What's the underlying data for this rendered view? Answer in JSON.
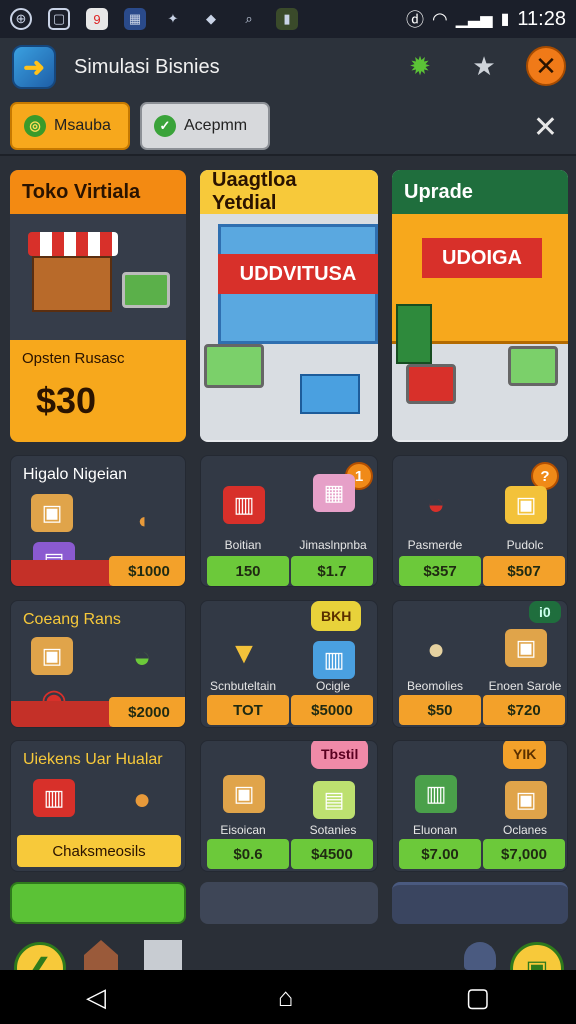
{
  "status": {
    "time": "11:28"
  },
  "header": {
    "title": "Simulasi Bisnies"
  },
  "tabs": [
    {
      "label": "Msauba"
    },
    {
      "label": "Acepmm"
    }
  ],
  "panels": [
    {
      "title": "Toko Virtiala",
      "footer_label": "Opsten Rusasc",
      "price": "$30"
    },
    {
      "title": "Uaagtloa Yetdial",
      "sign": "UDDVITUSA"
    },
    {
      "title": "Uprade",
      "sign": "UDOIGA"
    }
  ],
  "tiles": [
    {
      "label": "Higalo Nigeian",
      "price": "$1000"
    },
    {
      "items": [
        "Boitian",
        "Jimaslnpnba"
      ],
      "prices": [
        "150",
        "$1.7"
      ],
      "bubble": "1"
    },
    {
      "items": [
        "Pasmerde",
        "Pudolc"
      ],
      "prices": [
        "$357",
        "$507"
      ],
      "bubble": "?"
    },
    {
      "label": "Coeang Rans",
      "price": "$2000"
    },
    {
      "badge": "BKH",
      "items": [
        "Scnbuteltain",
        "Ocigle"
      ],
      "prices": [
        "TOT",
        "$5000"
      ]
    },
    {
      "badge_small": "i0",
      "items": [
        "Beomolies",
        "Enoen Sarole"
      ],
      "prices": [
        "$50",
        "$720"
      ]
    },
    {
      "label": "Uiekens Uar Hualar",
      "button": "Chaksmeosils"
    },
    {
      "badge": "Tbstil",
      "items": [
        "Eisoican",
        "Sotanies"
      ],
      "prices": [
        "$0.6",
        "$4500"
      ]
    },
    {
      "badge": "YIK",
      "items": [
        "Eluonan",
        "Oclanes"
      ],
      "prices": [
        "$7.00",
        "$7,000"
      ]
    }
  ],
  "colors": {
    "orange": "#f39a12",
    "yellow": "#f7c93a",
    "green": "#1f6e3d",
    "price_green": "#6cc93a",
    "price_orange": "#f3a12a"
  }
}
